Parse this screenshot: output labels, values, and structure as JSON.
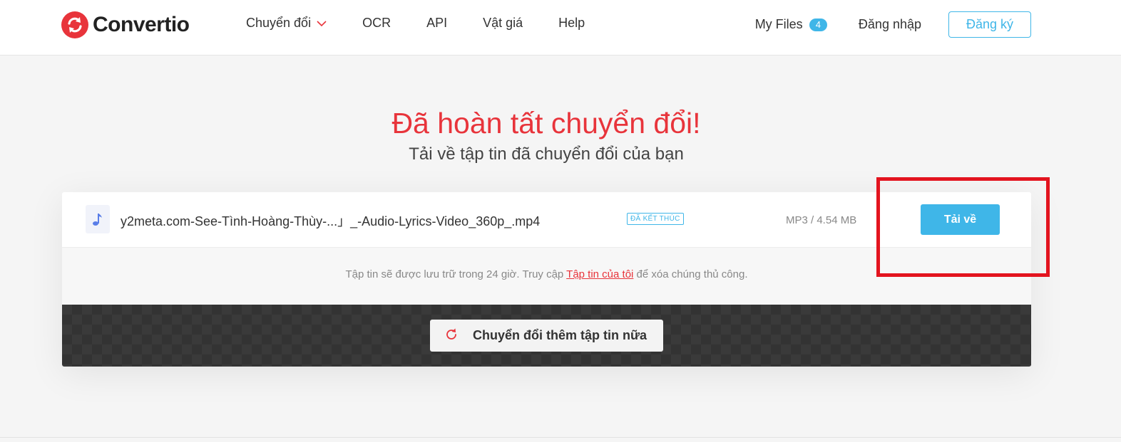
{
  "brand": {
    "name": "Convertio",
    "color": "#e8343b"
  },
  "nav": {
    "items": [
      {
        "label": "Chuyển đổi",
        "has_dropdown": true
      },
      {
        "label": "OCR"
      },
      {
        "label": "API"
      },
      {
        "label": "Vật giá"
      },
      {
        "label": "Help"
      }
    ]
  },
  "account": {
    "my_files_label": "My Files",
    "my_files_count": "4",
    "login_label": "Đăng nhập",
    "signup_label": "Đăng ký"
  },
  "main": {
    "title": "Đã hoàn tất chuyển đổi!",
    "subtitle": "Tải về tập tin đã chuyển đổi của bạn"
  },
  "file": {
    "icon": "music-note-icon",
    "name": "y2meta.com-See-Tình-Hoàng-Thùy-...」_-Audio-Lyrics-Video_360p_.mp4",
    "status": "ĐÃ KẾT THÚC",
    "size": "MP3 / 4.54 MB",
    "download_label": "Tải về"
  },
  "note": {
    "before": "Tập tin sẽ được lưu trữ trong 24 giờ. Truy cập ",
    "link": "Tập tin của tôi",
    "after": " để xóa chúng thủ công."
  },
  "actions": {
    "convert_more_label": "Chuyển đổi thêm tập tin nữa",
    "convert_more_icon": "refresh-icon"
  },
  "colors": {
    "accent_blue": "#3fb6e8",
    "accent_red": "#e8343b",
    "annotation_red": "#e3141f"
  }
}
